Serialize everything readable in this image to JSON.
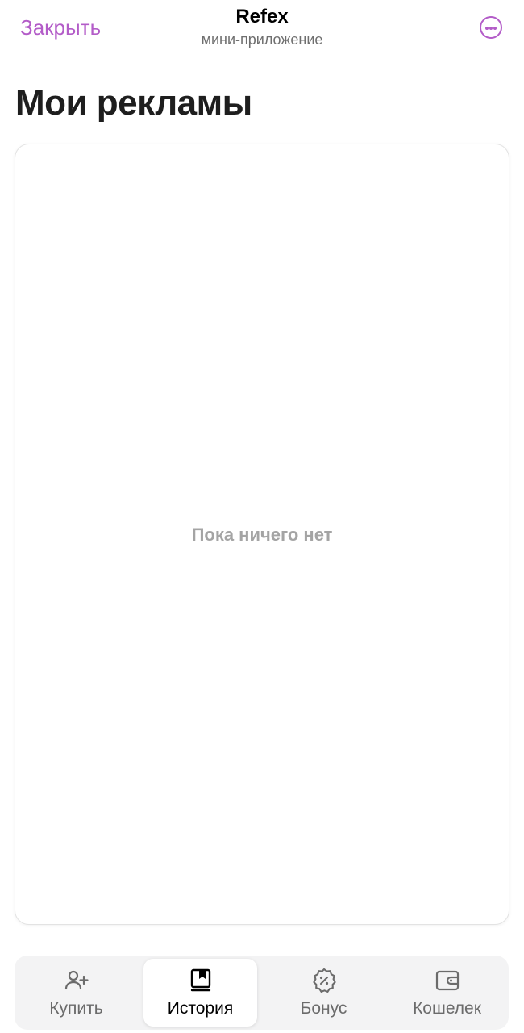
{
  "header": {
    "close_label": "Закрыть",
    "app_name": "Refex",
    "app_subtitle": "мини-приложение",
    "more_icon": "more-horizontal-icon",
    "accent_color": "#b35cc8"
  },
  "page": {
    "title": "Мои рекламы",
    "empty_state": "Пока ничего нет"
  },
  "tabs": [
    {
      "label": "Купить",
      "icon": "user-add-icon",
      "active": false
    },
    {
      "label": "История",
      "icon": "book-icon",
      "active": true
    },
    {
      "label": "Бонус",
      "icon": "discount-badge-icon",
      "active": false
    },
    {
      "label": "Кошелек",
      "icon": "wallet-icon",
      "active": false
    }
  ]
}
